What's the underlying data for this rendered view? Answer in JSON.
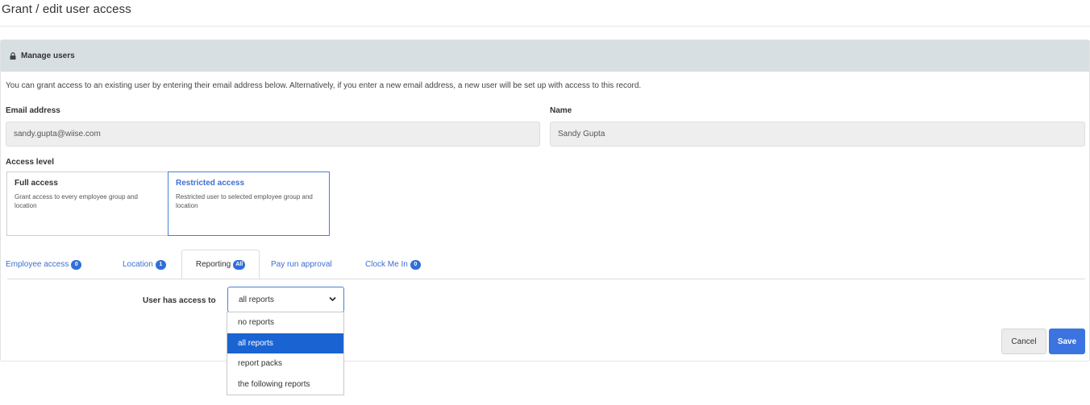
{
  "page": {
    "title": "Grant / edit user access"
  },
  "panel": {
    "header_label": "Manage users",
    "header_icon": "lock-icon",
    "intro": "You can grant access to an existing user by entering their email address below. Alternatively, if you enter a new email address, a new user will be set up with access to this record."
  },
  "form": {
    "email_label": "Email address",
    "email_value": "sandy.gupta@wiise.com",
    "name_label": "Name",
    "name_value": "Sandy Gupta"
  },
  "access_level": {
    "label": "Access level",
    "options": [
      {
        "title": "Full access",
        "description": "Grant access to every employee group and location",
        "selected": false
      },
      {
        "title": "Restricted access",
        "description": "Restricted user to selected employee group and location",
        "selected": true
      }
    ]
  },
  "tabs": [
    {
      "label": "Employee access",
      "badge": "0",
      "active": false
    },
    {
      "label": "Location",
      "badge": "1",
      "active": false
    },
    {
      "label": "Reporting",
      "badge": "All",
      "active": true
    },
    {
      "label": "Pay run approval",
      "badge": "",
      "active": false
    },
    {
      "label": "Clock Me In",
      "badge": "0",
      "active": false
    }
  ],
  "reporting": {
    "label": "User has access to",
    "selected": "all reports",
    "options": [
      "no reports",
      "all reports",
      "report packs",
      "the following reports"
    ]
  },
  "buttons": {
    "cancel": "Cancel",
    "save": "Save"
  },
  "colors": {
    "accent": "#3b74e0",
    "header_bg": "#d8dfe3",
    "selected_option": "#1a63d3"
  }
}
